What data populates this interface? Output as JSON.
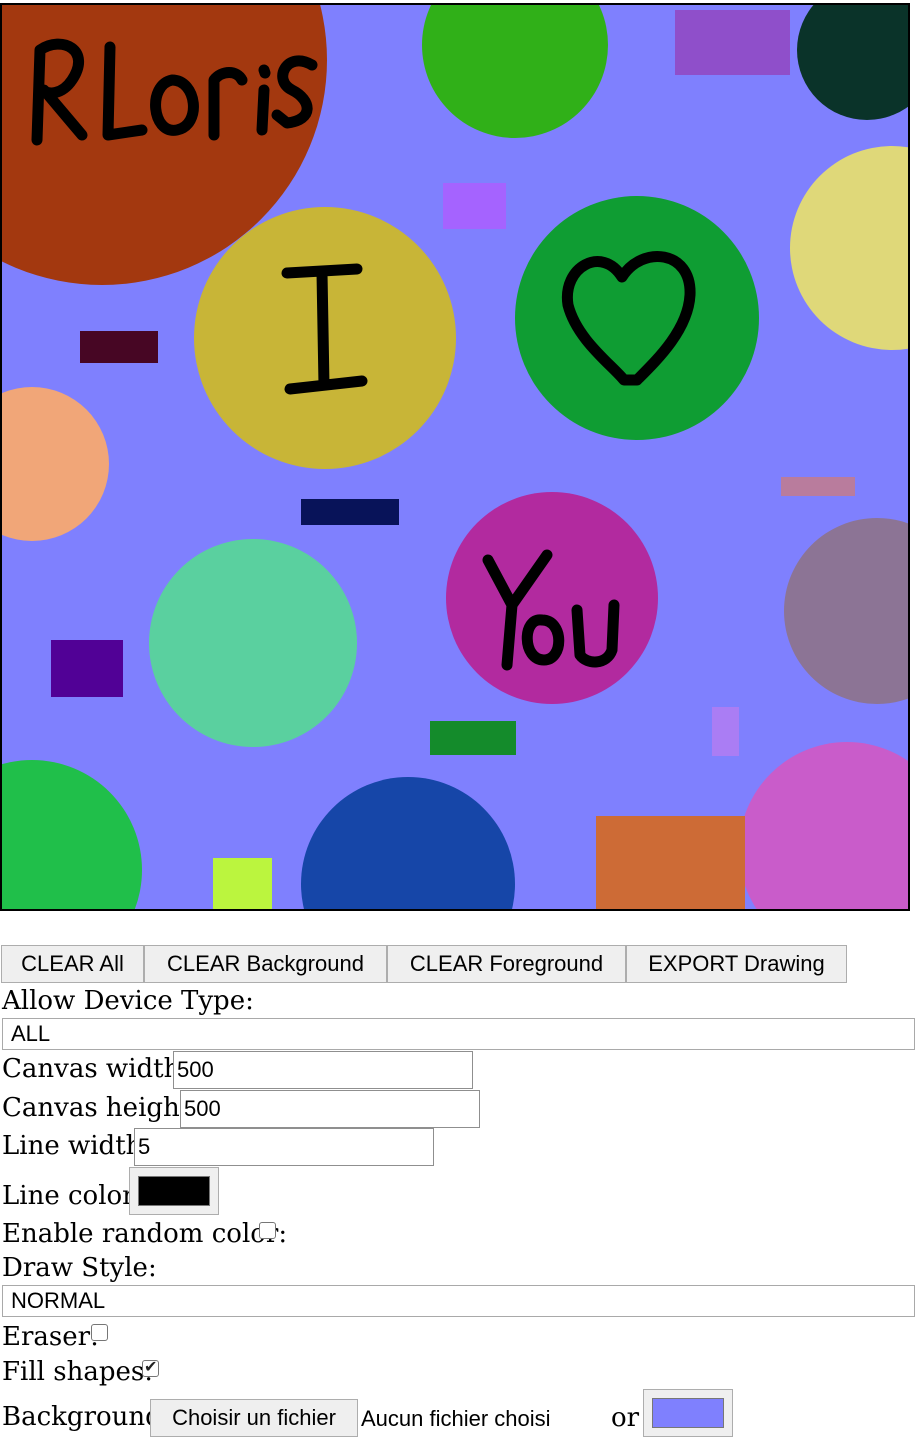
{
  "canvas": {
    "background_color": "#7f80fe",
    "handwriting_color": "#000000"
  },
  "toolbar": {
    "clear_all": "CLEAR All",
    "clear_background": "CLEAR Background",
    "clear_foreground": "CLEAR Foreground",
    "export_drawing": "EXPORT Drawing"
  },
  "settings": {
    "device_type_label": "Allow Device Type:",
    "device_type_value": "ALL",
    "canvas_width_label": "Canvas width:",
    "canvas_width_value": "500",
    "canvas_height_label": "Canvas height:",
    "canvas_height_value": "500",
    "line_width_label": "Line width:",
    "line_width_value": "5",
    "line_color_label": "Line color:",
    "line_color_value": "#000000",
    "random_color_label": "Enable random color:",
    "random_color_checked": false,
    "draw_style_label": "Draw Style:",
    "draw_style_value": "NORMAL",
    "eraser_label": "Eraser:",
    "eraser_checked": false,
    "fill_shapes_label": "Fill shapes:",
    "fill_shapes_checked": true,
    "background_label": "Background:",
    "file_button_label": "Choisir un fichier",
    "file_status": "Aucun fichier choisi",
    "or_label": "or",
    "background_color_value": "#7f80fe"
  }
}
